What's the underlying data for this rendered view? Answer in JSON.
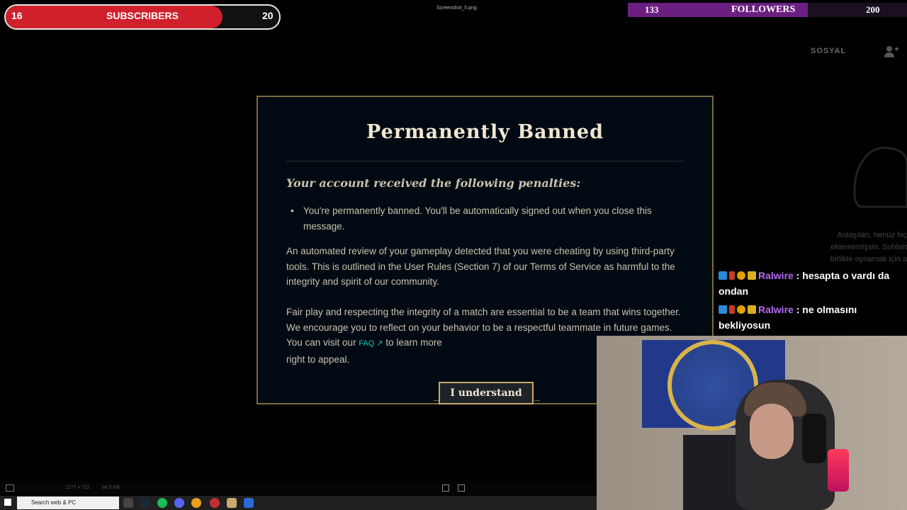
{
  "overlay": {
    "subscribers": {
      "start": "16",
      "label": "SUBSCRIBERS",
      "end": "20",
      "color": "#d0202b"
    },
    "followers": {
      "start": "133",
      "label": "FOLLOWERS",
      "end": "200",
      "color": "#6b1f80"
    }
  },
  "window": {
    "filename": "Screenshot_5.png"
  },
  "client": {
    "social_label": "SOSYAL",
    "empty_message": "Anlaşılan, henüz hiç eklememişsin. Sohbet birlikte oynamak için a"
  },
  "dialog": {
    "title": "Permanently Banned",
    "subtitle": "Your account received the following penalties:",
    "bullet": "You're permanently banned. You'll be automatically signed out when you close this message.",
    "paragraph1": "An automated review of your gameplay detected that you were cheating by using third-party tools. This is outlined in the User Rules (Section 7) of our Terms of Service as harmful to the integrity and spirit of our community.",
    "paragraph2_before": "Fair play and respecting the integrity of a match are essential to be a team that wins together. We encourage you to reflect on your behavior to be a respectful teammate in future games. You can visit our ",
    "faq_label": "FAQ ↗",
    "paragraph2_after": " to learn more",
    "paragraph2_end": "right to appeal.",
    "button_label": "I understand"
  },
  "chat": [
    {
      "user": "Ralwire",
      "message": "hesapta o vardı da ondan"
    },
    {
      "user": "Ralwire",
      "message": "ne olmasını bekliyosun"
    }
  ],
  "statusbar": {
    "dimensions": "1277 x 722",
    "filesize": "84.9 KB"
  },
  "taskbar": {
    "search_placeholder": "Search web & PC"
  }
}
